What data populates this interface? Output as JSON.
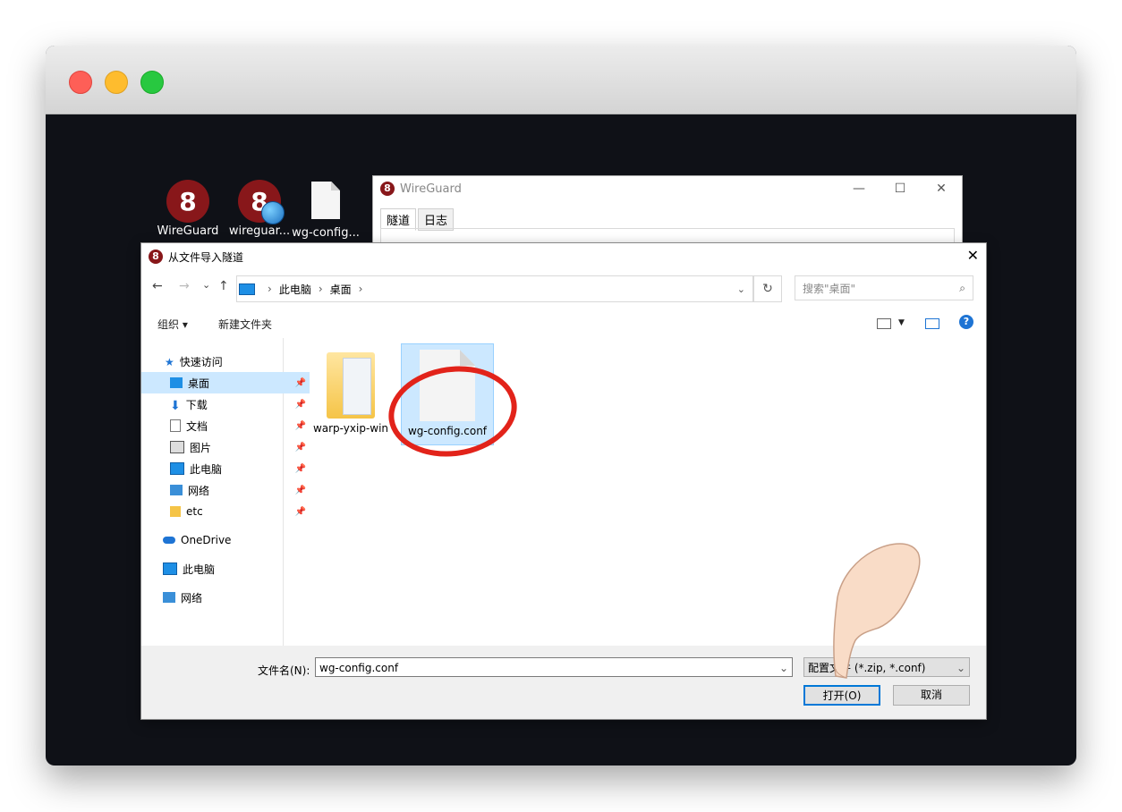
{
  "desktop": {
    "icons": [
      {
        "label": "WireGuard"
      },
      {
        "label": "wireguar..."
      },
      {
        "label": "wg-config..."
      }
    ]
  },
  "wg_window": {
    "title": "WireGuard",
    "tabs": [
      "隧道",
      "日志"
    ],
    "controls": {
      "minimize": "—",
      "maximize": "☐",
      "close": "✕"
    }
  },
  "dialog": {
    "title": "从文件导入隧道",
    "close": "✕",
    "nav": {
      "back": "←",
      "forward": "→",
      "recent": "⌄",
      "up": "↑",
      "breadcrumb": [
        "此电脑",
        "桌面"
      ],
      "separator": "›",
      "dropdown": "⌄",
      "refresh": "↻",
      "search_placeholder": "搜索\"桌面\""
    },
    "toolbar": {
      "organize": "组织 ▾",
      "new_folder": "新建文件夹",
      "help": "?"
    },
    "sidebar": [
      {
        "label": "快速访问",
        "icon": "star-icon",
        "pinned": false
      },
      {
        "label": "桌面",
        "icon": "desktop-icon",
        "pinned": true
      },
      {
        "label": "下载",
        "icon": "download-icon",
        "pinned": true
      },
      {
        "label": "文档",
        "icon": "document-icon",
        "pinned": true
      },
      {
        "label": "图片",
        "icon": "pictures-icon",
        "pinned": true
      },
      {
        "label": "此电脑",
        "icon": "computer-icon",
        "pinned": true
      },
      {
        "label": "网络",
        "icon": "network-icon",
        "pinned": true
      },
      {
        "label": "etc",
        "icon": "folder-icon",
        "pinned": true
      },
      {
        "label": "OneDrive",
        "icon": "cloud-icon",
        "pinned": false
      },
      {
        "label": "此电脑",
        "icon": "computer-icon",
        "pinned": false
      },
      {
        "label": "网络",
        "icon": "network-icon",
        "pinned": false
      }
    ],
    "files": [
      {
        "name": "warp-yxip-win",
        "type": "folder"
      },
      {
        "name": "wg-config.conf",
        "type": "file",
        "selected": true
      }
    ],
    "footer": {
      "filename_label": "文件名(N):",
      "filename_value": "wg-config.conf",
      "filter": "配置文件 (*.zip, *.conf)",
      "open": "打开(O)",
      "cancel": "取消"
    }
  },
  "colors": {
    "accent": "#0078d7",
    "selection": "#cce8ff",
    "annotation": "#e2231a",
    "wireguard": "#88171a"
  }
}
